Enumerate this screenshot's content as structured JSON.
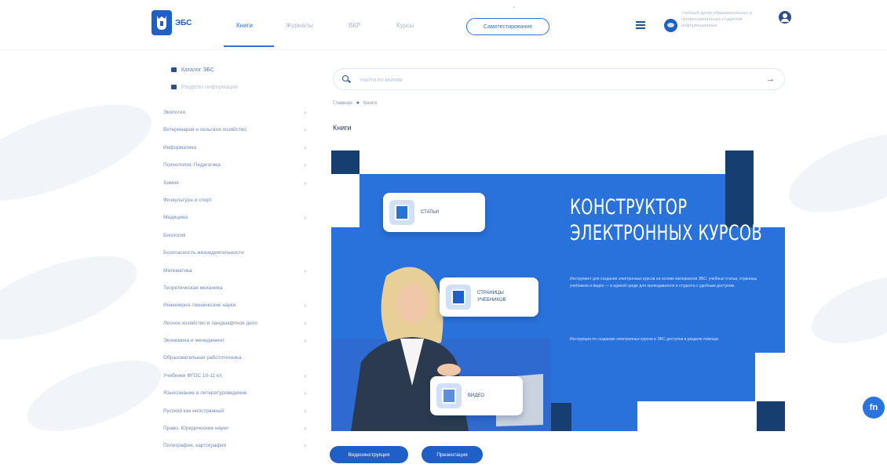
{
  "colors": {
    "accent": "#2a74e0",
    "navy": "#1c4a86",
    "banner_blue": "#2a72db"
  },
  "header": {
    "logo_text": "ЭБС",
    "tabs": [
      {
        "label": "Книги",
        "active": true
      },
      {
        "label": "Журналы",
        "active": false
      },
      {
        "label": "ВКР",
        "active": false
      },
      {
        "label": "Курсы",
        "active": false
      }
    ],
    "selftest_label": "Самотестирование",
    "org_text": "Учебный центр образовательных и профессиональных студентов информационных"
  },
  "sidebar": {
    "top_items": [
      {
        "label": "Каталог ЭБС",
        "icon": "catalog-icon"
      },
      {
        "label": "Разделы информации",
        "icon": "section-icon"
      }
    ],
    "categories": [
      {
        "label": "Экология",
        "has_children": true
      },
      {
        "label": "Ветеринария и сельское хозяйство",
        "has_children": true
      },
      {
        "label": "Информатика",
        "has_children": true
      },
      {
        "label": "Психология. Педагогика",
        "has_children": true
      },
      {
        "label": "Химия",
        "has_children": true
      },
      {
        "label": "Физкультура и спорт",
        "has_children": false
      },
      {
        "label": "Медицина",
        "has_children": true
      },
      {
        "label": "Биология",
        "has_children": false
      },
      {
        "label": "Безопасность жизнедеятельности",
        "has_children": false
      },
      {
        "label": "Математика",
        "has_children": true
      },
      {
        "label": "Теоретическая механика",
        "has_children": false
      },
      {
        "label": "Инженерно-технические науки",
        "has_children": true
      },
      {
        "label": "Лесное хозяйство и ландшафтное дело",
        "has_children": true
      },
      {
        "label": "Экономика и менеджмент",
        "has_children": true
      },
      {
        "label": "Образовательная работотехника",
        "has_children": false
      },
      {
        "label": "Учебники ФГОС 10-11 кл.",
        "has_children": true
      },
      {
        "label": "Языкознание и литературоведение",
        "has_children": true
      },
      {
        "label": "Русский как иностранный",
        "has_children": true
      },
      {
        "label": "Право. Юридические науки",
        "has_children": true
      },
      {
        "label": "Полиграфия, картография",
        "has_children": true
      }
    ]
  },
  "main": {
    "search_placeholder": "Найти по книгам",
    "breadcrumb": [
      "Главная",
      "Книги"
    ],
    "page_title": "Книги"
  },
  "banner": {
    "title_line1": "КОНСТРУКТОР",
    "title_line2": "ЭЛЕКТРОННЫХ КУРСОВ",
    "description": "Инструмент для создания электронных курсов на основе материалов ЭБС: учебные статьи, страницы учебников и видео — в единой среде для преподавателя и студента с удобным доступом.",
    "description2": "Инструкция по созданию электронных курсов в ЭБС доступна в разделе помощи.",
    "cards": [
      {
        "label": "СТАТЬИ",
        "icon": "article-icon"
      },
      {
        "label": "СТРАНИЦЫ УЧЕБНИКОВ",
        "icon": "textbook-page-icon"
      },
      {
        "label": "ВИДЕО",
        "icon": "video-icon"
      }
    ]
  },
  "buttons": {
    "video_instruction": "Видеоинструкция",
    "presentation": "Презентация"
  },
  "fab": {
    "label": "fn"
  }
}
